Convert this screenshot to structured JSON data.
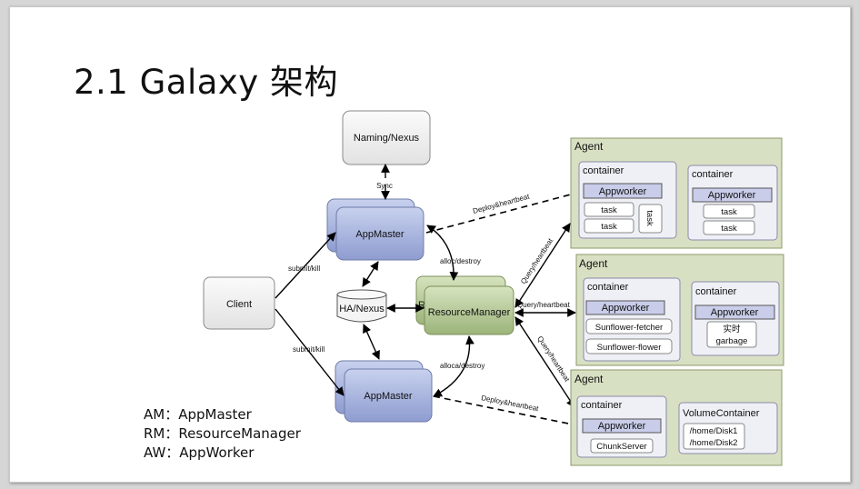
{
  "title": "2.1 Galaxy 架构",
  "legend": [
    "AM：AppMaster",
    "RM：ResourceManager",
    "AW：AppWorker"
  ],
  "nodes": {
    "naming": "Naming/Nexus",
    "appmaster_top": "AppMaster",
    "appmaster_bottom": "AppMaster",
    "client": "Client",
    "ha_nexus": "HA/Nexus",
    "resource_manager": "ResourceManager",
    "rm_back_label": "R"
  },
  "edges": {
    "sync": "Sync",
    "submit_kill_top": "submit/kill",
    "submit_kill_bottom": "submit/kill",
    "alloc_destroy": "alloc/destroy",
    "alloca_destroy": "alloca/destroy",
    "deploy_heartbeat_top": "Deploy&heartbeat",
    "deploy_heartbeat_bottom": "Deploy&heartbeat",
    "query_heartbeat_1": "Query/heartbeat",
    "query_heartbeat_2": "Query/heartbeat",
    "query_heartbeat_3": "Query/heartbeat"
  },
  "agents": [
    {
      "label": "Agent",
      "containers": [
        {
          "label": "container",
          "worker": "Appworker",
          "tasks": [
            "task",
            "task"
          ],
          "side_task": "task"
        },
        {
          "label": "container",
          "worker": "Appworker",
          "tasks": [
            "task",
            "task"
          ]
        }
      ]
    },
    {
      "label": "Agent",
      "containers": [
        {
          "label": "container",
          "worker": "Appworker",
          "tasks": [
            "Sunflower-fetcher",
            "Sunflower-flower"
          ]
        },
        {
          "label": "container",
          "worker": "Appworker",
          "garbage": [
            "实时",
            "garbage"
          ]
        }
      ]
    },
    {
      "label": "Agent",
      "containers": [
        {
          "label": "container",
          "worker": "Appworker",
          "tasks": [
            "ChunkServer"
          ]
        }
      ],
      "volume": {
        "label": "VolumeContainer",
        "disks": [
          "/home/Disk1",
          "/home/Disk2"
        ]
      }
    }
  ],
  "colors": {
    "appmaster_fill": "#a9b5dc",
    "rm_fill": "#b9cc9c",
    "agent_fill": "#d8e0c3",
    "agent_border": "#8b9a6a",
    "worker_fill": "#c9cde9",
    "box_border": "#7a7a9a"
  }
}
